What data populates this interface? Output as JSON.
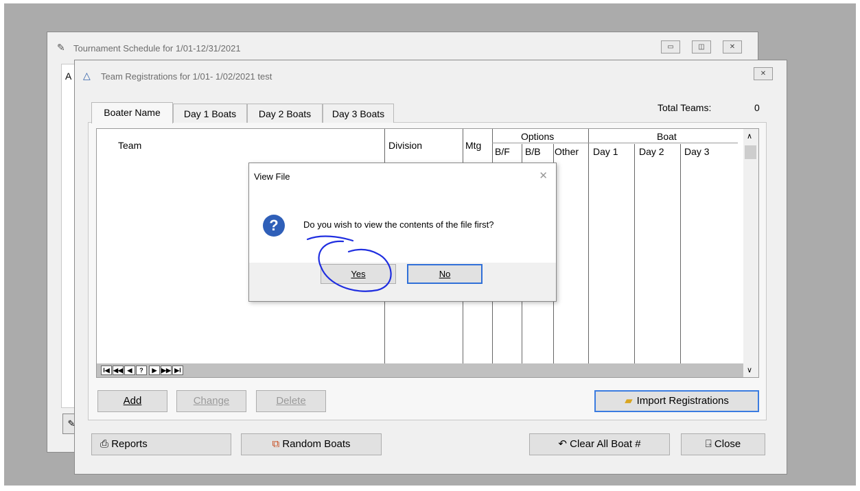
{
  "back_window": {
    "title": "Tournament Schedule for  1/01-12/31/2021",
    "inner_letter": "A",
    "title_icon": "tournament-icon"
  },
  "front_window": {
    "title": "Team Registrations for  1/01- 1/02/2021 test",
    "title_icon": "team-icon",
    "tabs": [
      {
        "label": "Boater Name"
      },
      {
        "label": "Day 1 Boats"
      },
      {
        "label": "Day 2 Boats"
      },
      {
        "label": "Day 3 Boats"
      }
    ],
    "total_label": "Total Teams:",
    "total_value": "0",
    "grid": {
      "headers": {
        "team": "Team",
        "division": "Division",
        "mtg": "Mtg",
        "options": "Options",
        "bf": "B/F",
        "bb": "B/B",
        "other": "Other",
        "boat": "Boat",
        "day1": "Day 1",
        "day2": "Day 2",
        "day3": "Day 3"
      },
      "nav_buttons": [
        "I◀",
        "◀◀",
        "◀",
        "?",
        "▶",
        "▶▶",
        "▶I"
      ]
    },
    "buttons": {
      "add": "Add",
      "change": "Change",
      "delete": "Delete",
      "import": "Import Registrations",
      "reports": "Reports",
      "random": "Random Boats",
      "clear": "Clear All Boat #",
      "close": "Close"
    }
  },
  "dialog": {
    "title": "View File",
    "message": "Do you wish to view the contents of the file first?",
    "yes": "Yes",
    "no": "No"
  },
  "colors": {
    "accent": "#2f6fd8",
    "annotation": "#1f2ee0"
  }
}
